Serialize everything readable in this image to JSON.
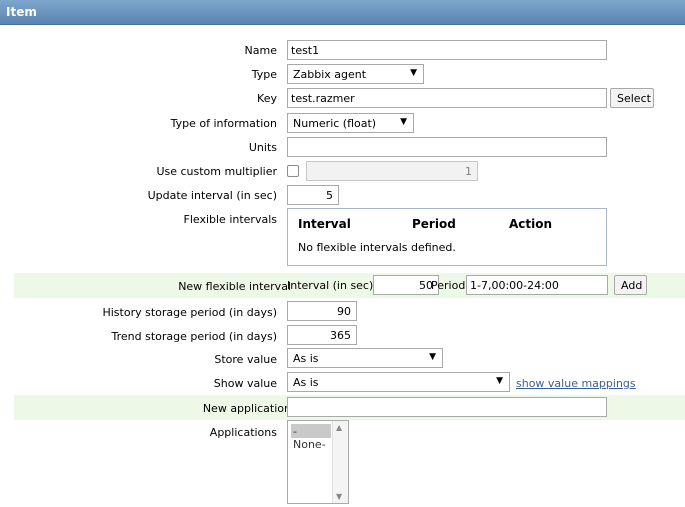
{
  "header": {
    "title": "Item"
  },
  "form": {
    "name": {
      "label": "Name",
      "value": "test1"
    },
    "type": {
      "label": "Type",
      "value": "Zabbix agent"
    },
    "key": {
      "label": "Key",
      "value": "test.razmer",
      "select_label": "Select"
    },
    "type_of_information": {
      "label": "Type of information",
      "value": "Numeric (float)"
    },
    "units": {
      "label": "Units",
      "value": ""
    },
    "custom_multiplier": {
      "label": "Use custom multiplier",
      "checked": false,
      "value": "1"
    },
    "update_interval": {
      "label": "Update interval (in sec)",
      "value": "5"
    },
    "flexible_intervals": {
      "label": "Flexible intervals",
      "columns": [
        "Interval",
        "Period",
        "Action"
      ],
      "empty_text": "No flexible intervals defined."
    },
    "new_flexible_interval": {
      "label": "New flexible interval",
      "interval_label": "Interval (in sec)",
      "interval_value": "50",
      "period_label": "Period",
      "period_value": "1-7,00:00-24:00",
      "add_label": "Add"
    },
    "history": {
      "label": "History storage period (in days)",
      "value": "90"
    },
    "trends": {
      "label": "Trend storage period (in days)",
      "value": "365"
    },
    "store_value": {
      "label": "Store value",
      "value": "As is"
    },
    "show_value": {
      "label": "Show value",
      "value": "As is",
      "link": "show value mappings"
    },
    "new_application": {
      "label": "New application",
      "value": ""
    },
    "applications": {
      "label": "Applications",
      "options": [
        "-None-"
      ]
    }
  }
}
